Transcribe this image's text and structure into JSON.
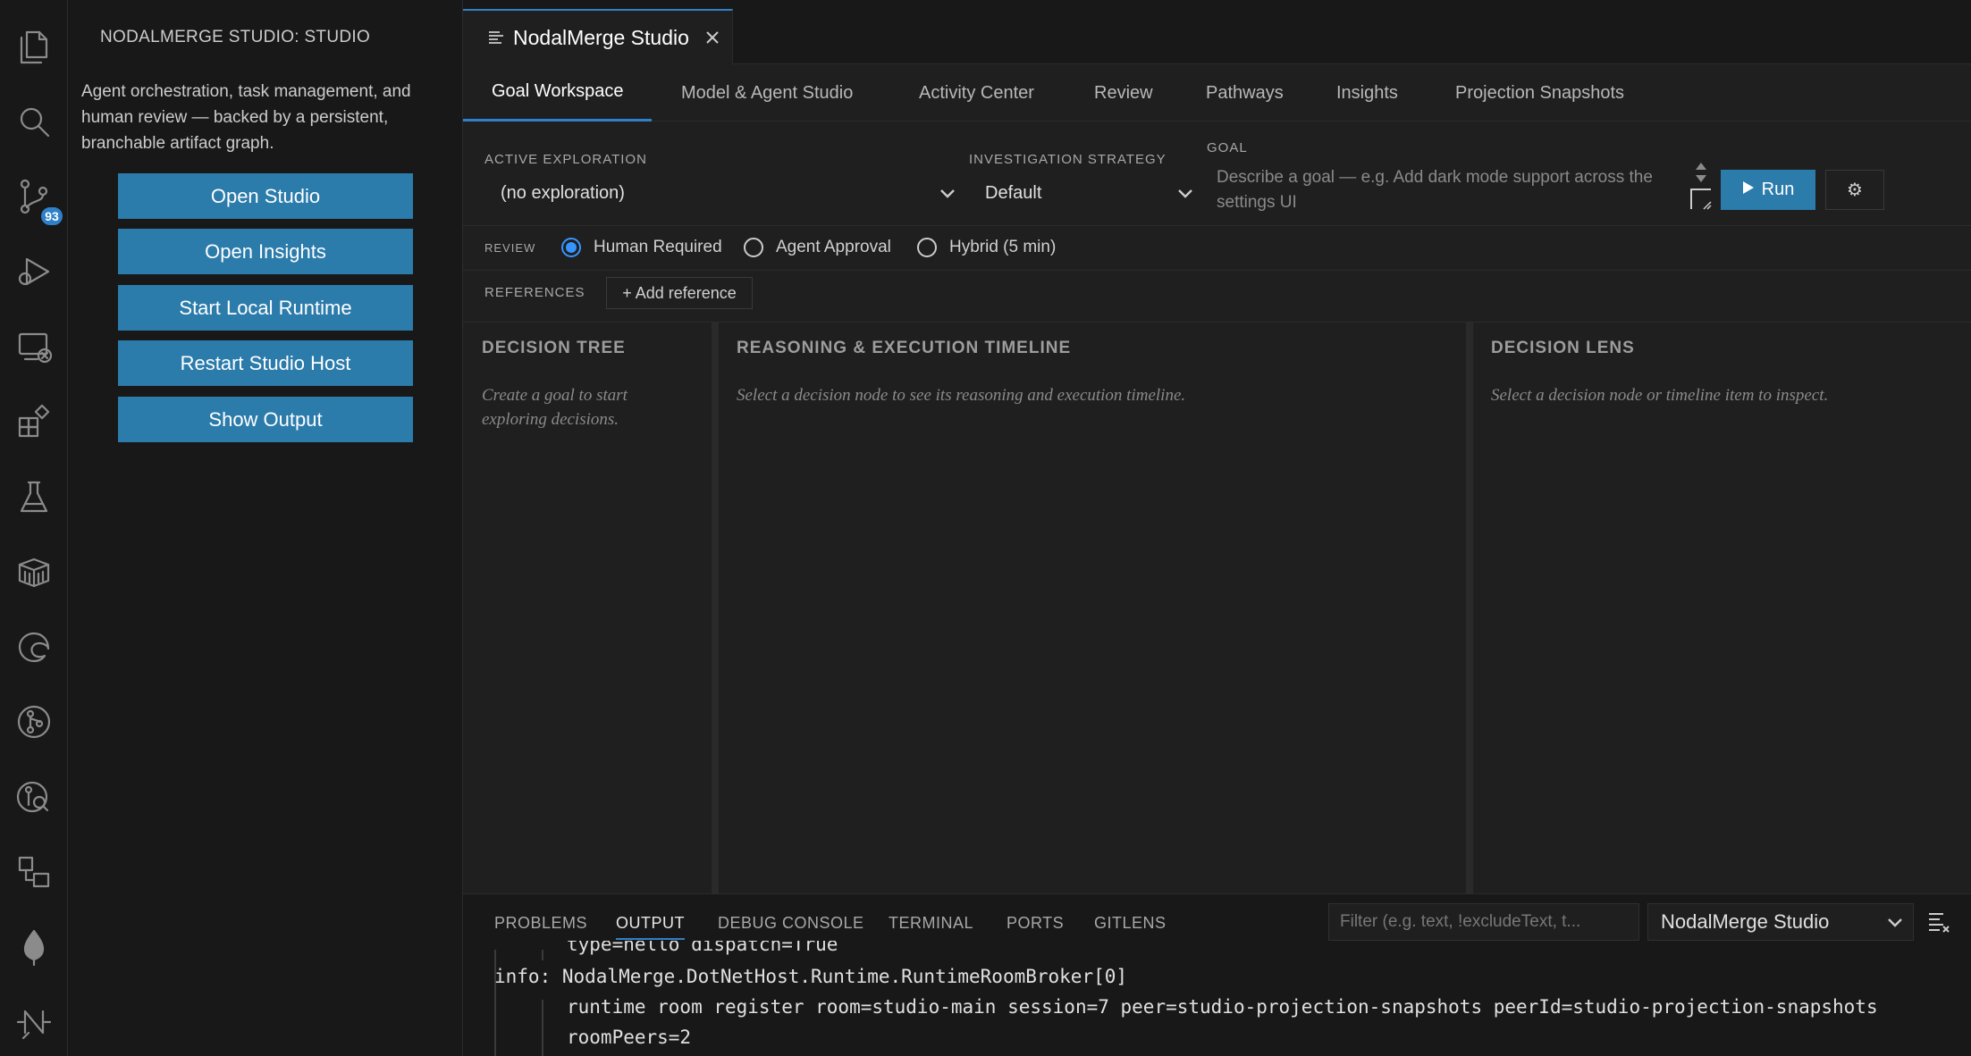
{
  "sidebar": {
    "title": "NODALMERGE STUDIO: STUDIO",
    "description": "Agent orchestration, task management, and human review — backed by a persistent, branchable artifact graph.",
    "buttons": [
      "Open Studio",
      "Open Insights",
      "Start Local Runtime",
      "Restart Studio Host",
      "Show Output"
    ]
  },
  "activity_bar": {
    "icons": [
      "explorer-icon",
      "search-icon",
      "source-control-icon",
      "run-debug-icon",
      "remote-explorer-icon",
      "extensions-icon",
      "testing-icon",
      "containers-icon",
      "edge-tools-icon",
      "git-graph-icon",
      "git-lens-icon",
      "workflow-icon",
      "mongodb-icon",
      "nodalmerge-icon"
    ],
    "source_control_badge": "93"
  },
  "editor": {
    "tab_title": "NodalMerge Studio",
    "sub_tabs": [
      "Goal Workspace",
      "Model & Agent Studio",
      "Activity Center",
      "Review",
      "Pathways",
      "Insights",
      "Projection Snapshots"
    ],
    "active_sub_tab": "Goal Workspace",
    "active_exploration_label": "ACTIVE EXPLORATION",
    "active_exploration_value": "(no exploration)",
    "strategy_label": "INVESTIGATION STRATEGY",
    "strategy_value": "Default",
    "goal_label": "GOAL",
    "goal_placeholder": "Describe a goal — e.g. Add dark mode support across the settings UI",
    "run_label": "Run",
    "settings_glyph": "⚙",
    "review_label": "REVIEW",
    "review_options": [
      "Human Required",
      "Agent Approval",
      "Hybrid (5 min)"
    ],
    "review_selected": "Human Required",
    "references_label": "REFERENCES",
    "add_reference_label": "+ Add reference",
    "panes": {
      "tree_title": "DECISION TREE",
      "tree_empty": "Create a goal to start exploring decisions.",
      "timeline_title": "REASONING & EXECUTION TIMELINE",
      "timeline_empty": "Select a decision node to see its reasoning and execution timeline.",
      "lens_title": "DECISION LENS",
      "lens_empty": "Select a decision node or timeline item to inspect."
    }
  },
  "panel": {
    "tabs": [
      "PROBLEMS",
      "OUTPUT",
      "DEBUG CONSOLE",
      "TERMINAL",
      "PORTS",
      "GITLENS"
    ],
    "active_tab": "OUTPUT",
    "filter_placeholder": "Filter (e.g. text, !excludeText, t...",
    "channel": "NodalMerge Studio",
    "log_lines": [
      "type=hello dispatch=True",
      "info: NodalMerge.DotNetHost.Runtime.RuntimeRoomBroker[0]",
      "runtime room register room=studio-main session=7 peer=studio-projection-snapshots peerId=studio-projection-snapshots",
      "roomPeers=2"
    ]
  },
  "colors": {
    "accent": "#2f80c9",
    "button": "#2b7bab",
    "background": "#1f1f1f",
    "sidebar": "#181818"
  }
}
